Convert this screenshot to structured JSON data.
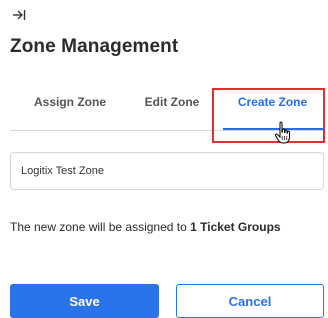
{
  "header": {
    "collapse_icon": "arrow-right-to-bar-icon",
    "title": "Zone Management"
  },
  "tabs": [
    {
      "label": "Assign Zone",
      "active": false
    },
    {
      "label": "Edit Zone",
      "active": false
    },
    {
      "label": "Create Zone",
      "active": true
    }
  ],
  "form": {
    "zone_name_value": "Logitix Test Zone"
  },
  "info": {
    "prefix": "The new zone will be assigned to ",
    "count_text": "1 Ticket Groups"
  },
  "buttons": {
    "save_label": "Save",
    "cancel_label": "Cancel"
  },
  "colors": {
    "accent": "#2b73ea",
    "highlight": "#e0312f"
  }
}
